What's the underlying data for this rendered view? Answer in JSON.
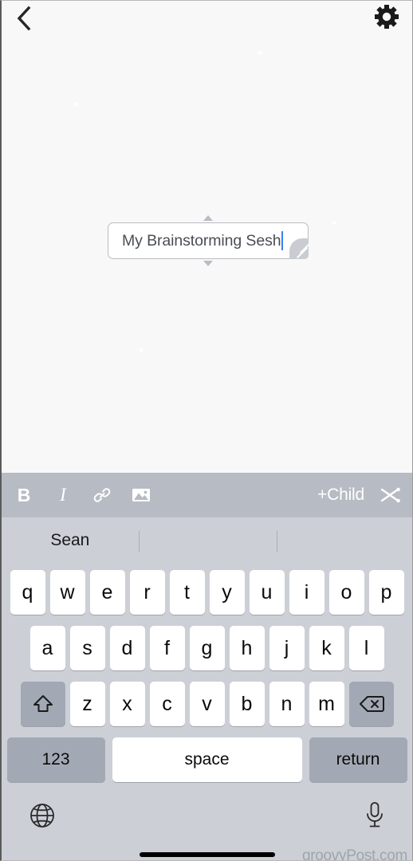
{
  "app": {
    "screen": "mindmap-node-editing",
    "canvas_bg": "#f8f8f9"
  },
  "nav": {
    "back_icon": "chevron-left-icon",
    "settings_icon": "gear-icon"
  },
  "node": {
    "text": "My Brainstorming Sesh",
    "caret_color": "#3d7ff0",
    "border_color": "#b9bcc0",
    "resize_handle": "resize-grip-icon",
    "collapse_up_icon": "triangle-up-icon",
    "collapse_down_icon": "triangle-down-icon"
  },
  "toolbar": {
    "background": "#b7bbc4",
    "bold_label": "B",
    "italic_label": "I",
    "link_icon": "link-icon",
    "image_icon": "image-icon",
    "add_child_label": "+Child",
    "cut_icon": "scissors-icon"
  },
  "keyboard": {
    "background": "#ccd0d6",
    "predictions": [
      "Sean",
      "",
      ""
    ],
    "rows": [
      [
        "q",
        "w",
        "e",
        "r",
        "t",
        "y",
        "u",
        "i",
        "o",
        "p"
      ],
      [
        "a",
        "s",
        "d",
        "f",
        "g",
        "h",
        "j",
        "k",
        "l"
      ],
      [
        "z",
        "x",
        "c",
        "v",
        "b",
        "n",
        "m"
      ]
    ],
    "shift_icon": "shift-arrow-icon",
    "backspace_icon": "backspace-icon",
    "numeric_label": "123",
    "space_label": "space",
    "return_label": "return",
    "globe_icon": "globe-icon",
    "mic_icon": "microphone-icon"
  },
  "watermark": {
    "text": "groovyPost.com"
  }
}
